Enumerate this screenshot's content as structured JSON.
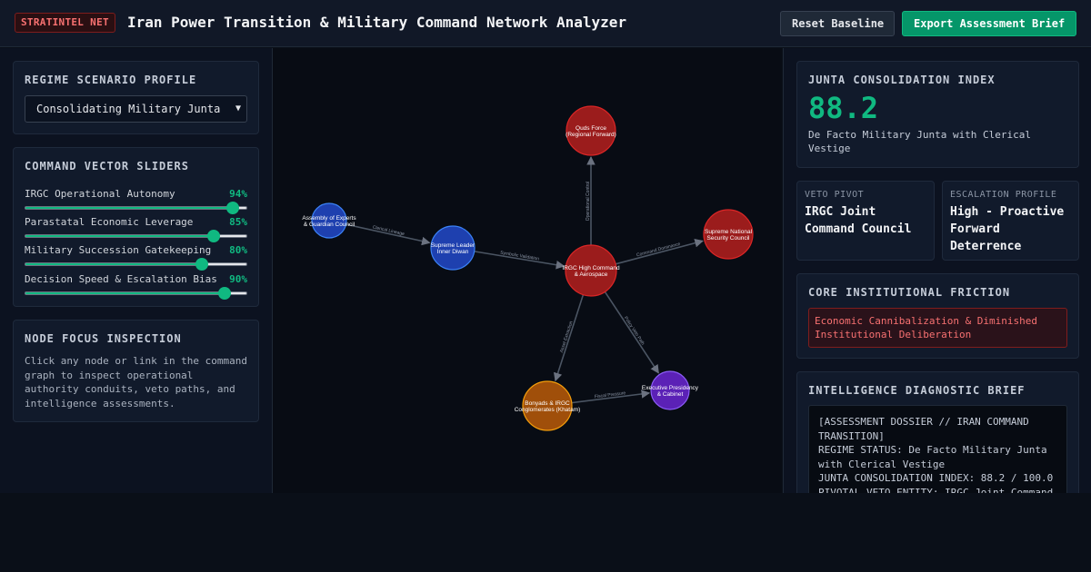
{
  "header": {
    "badge": "STRATINTEL NET",
    "title": "Iran Power Transition & Military Command Network Analyzer",
    "reset_label": "Reset Baseline",
    "export_label": "Export Assessment Brief"
  },
  "scenario": {
    "title": "REGIME SCENARIO PROFILE",
    "selected": "Consolidating Military Junta"
  },
  "sliders": {
    "title": "COMMAND VECTOR SLIDERS",
    "items": [
      {
        "label": "IRGC Operational Autonomy",
        "value": 94,
        "display": "94%"
      },
      {
        "label": "Parastatal Economic Leverage",
        "value": 85,
        "display": "85%"
      },
      {
        "label": "Military Succession Gatekeeping",
        "value": 80,
        "display": "80%"
      },
      {
        "label": "Decision Speed & Escalation Bias",
        "value": 90,
        "display": "90%"
      }
    ]
  },
  "inspection": {
    "title": "NODE FOCUS INSPECTION",
    "text": "Click any node or link in the command graph to inspect operational authority conduits, veto paths, and intelligence assessments."
  },
  "index": {
    "title": "JUNTA CONSOLIDATION INDEX",
    "value": "88.2",
    "subtitle": "De Facto Military Junta with Clerical Vestige"
  },
  "veto": {
    "label": "VETO PIVOT",
    "value": "IRGC Joint Command Council"
  },
  "escalation": {
    "label": "ESCALATION PROFILE",
    "value": "High - Proactive Forward Deterrence"
  },
  "friction": {
    "title": "CORE INSTITUTIONAL FRICTION",
    "text": "Economic Cannibalization & Diminished Institutional Deliberation"
  },
  "brief": {
    "title": "INTELLIGENCE DIAGNOSTIC BRIEF",
    "lines": [
      "[ASSESSMENT DOSSIER // IRAN COMMAND TRANSITION]",
      "REGIME STATUS: De Facto Military Junta with Clerical Vestige",
      "JUNTA CONSOLIDATION INDEX: 88.2 / 100.0",
      "PIVOTAL VETO ENTITY: IRGC Joint Command Council"
    ]
  },
  "graph": {
    "colors": {
      "military": "#9b1c1c",
      "clerical": "#1e40af",
      "economic": "#a04f0a",
      "executive": "#5b21b6",
      "edge": "#4b5563"
    },
    "nodes": [
      {
        "id": "irgc",
        "lines": [
          "IRGC High Command",
          "& Aerospace"
        ],
        "kind": "military"
      },
      {
        "id": "quds",
        "lines": [
          "Quds Force",
          "(Regional Forward)"
        ],
        "kind": "military"
      },
      {
        "id": "snsc",
        "lines": [
          "Supreme National",
          "Security Council"
        ],
        "kind": "military"
      },
      {
        "id": "leader",
        "lines": [
          "Supreme Leader",
          "Inner Diwan"
        ],
        "kind": "clerical"
      },
      {
        "id": "experts",
        "lines": [
          "Assembly of Experts",
          "& Guardian Council"
        ],
        "kind": "clerical"
      },
      {
        "id": "bonyads",
        "lines": [
          "Bonyads & IRGC",
          "Conglomerates (Khatam)"
        ],
        "kind": "economic"
      },
      {
        "id": "exec",
        "lines": [
          "Executive Presidency",
          "& Cabinet"
        ],
        "kind": "executive"
      }
    ],
    "edges": [
      {
        "from": "irgc",
        "to": "quds",
        "label": "Operational Control"
      },
      {
        "from": "irgc",
        "to": "snsc",
        "label": "Command Dominance"
      },
      {
        "from": "leader",
        "to": "irgc",
        "label": "Symbolic Validation"
      },
      {
        "from": "experts",
        "to": "leader",
        "label": "Clerical Lineage"
      },
      {
        "from": "irgc",
        "to": "bonyads",
        "label": "Asset Extraction"
      },
      {
        "from": "irgc",
        "to": "exec",
        "label": "Policy Veto Path"
      },
      {
        "from": "bonyads",
        "to": "exec",
        "label": "Fiscal Pressure"
      }
    ]
  }
}
